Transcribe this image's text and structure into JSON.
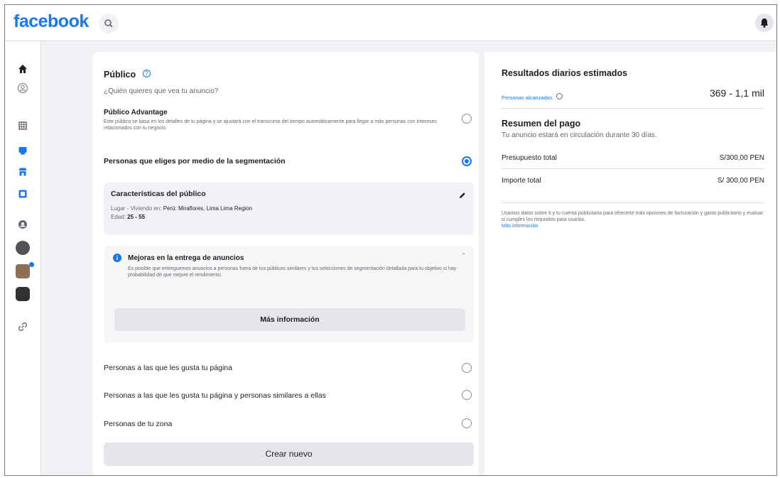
{
  "app": {
    "logo": "facebook"
  },
  "header": {
    "search_icon": "search-icon",
    "bell_icon": "bell-icon"
  },
  "sidebar": {
    "items": [
      {
        "name": "home",
        "icon": "home-icon"
      },
      {
        "name": "profile",
        "icon": "profile-icon"
      },
      {
        "name": "grid",
        "icon": "grid-icon"
      },
      {
        "name": "ads",
        "icon": "ads-icon"
      },
      {
        "name": "shop",
        "icon": "shop-icon"
      },
      {
        "name": "pages",
        "icon": "pages-icon"
      },
      {
        "name": "groups",
        "icon": "groups-icon"
      },
      {
        "name": "avatar-1",
        "icon": "avatar"
      },
      {
        "name": "avatar-2",
        "icon": "avatar"
      },
      {
        "name": "avatar-3",
        "icon": "avatar"
      },
      {
        "name": "link",
        "icon": "link-icon"
      }
    ]
  },
  "audience": {
    "title": "Público",
    "question": "¿Quién quieres que vea tu anuncio?",
    "advantage": {
      "label": "Público Advantage",
      "description": "Este público se basa en los detalles de tu página y se ajustará con el transcurso del tiempo automáticamente para llegar a más personas con intereses relacionados con tu negocio.",
      "selected": false
    },
    "segmentation": {
      "label": "Personas que eliges por medio de la segmentación",
      "selected": true
    },
    "characteristics": {
      "title": "Características del público",
      "location_prefix": "Lugar - Viviendo en:",
      "location_value": "Perú: Miraflores, Lima Lima Region",
      "age_prefix": "Edad:",
      "age_value": "25 - 55"
    },
    "delivery": {
      "title": "Mejoras en la entrega de anuncios",
      "description": "Es posible que entreguemos anuncios a personas fuera de tus públicos similares y tus selecciones de segmentación detallada para tu objetivo si hay probabilidad de que mejore el rendimiento.",
      "button": "Más información"
    },
    "options": [
      {
        "label": "Personas a las que les gusta tu página",
        "selected": false
      },
      {
        "label": "Personas a las que les gusta tu página y personas similares a ellas",
        "selected": false
      },
      {
        "label": "Personas de tu zona",
        "selected": false
      }
    ],
    "create_button": "Crear nuevo"
  },
  "results": {
    "title": "Resultados diarios estimados",
    "reach_label": "Personas alcanzadas",
    "reach_value": "369 - 1,1 mil"
  },
  "payment": {
    "title": "Resumen del pago",
    "subtitle": "Tu anuncio estará en circulación durante 30 días.",
    "rows": [
      {
        "label": "Presupuesto total",
        "value": "S/300,00 PEN"
      },
      {
        "label": "Importe total",
        "value": "S/ 300,00 PEN"
      }
    ],
    "note": "Usamos datos sobre ti y tu cuenta publicitaria para ofrecerte más opciones de facturación y gasto publicitario y evaluar si cumples los requisitos para usarlas.",
    "note_link": "Más información"
  },
  "colors": {
    "brand": "#1877f2",
    "bg": "#f0f2f5",
    "text": "#1c1e21",
    "muted": "#65676b"
  }
}
